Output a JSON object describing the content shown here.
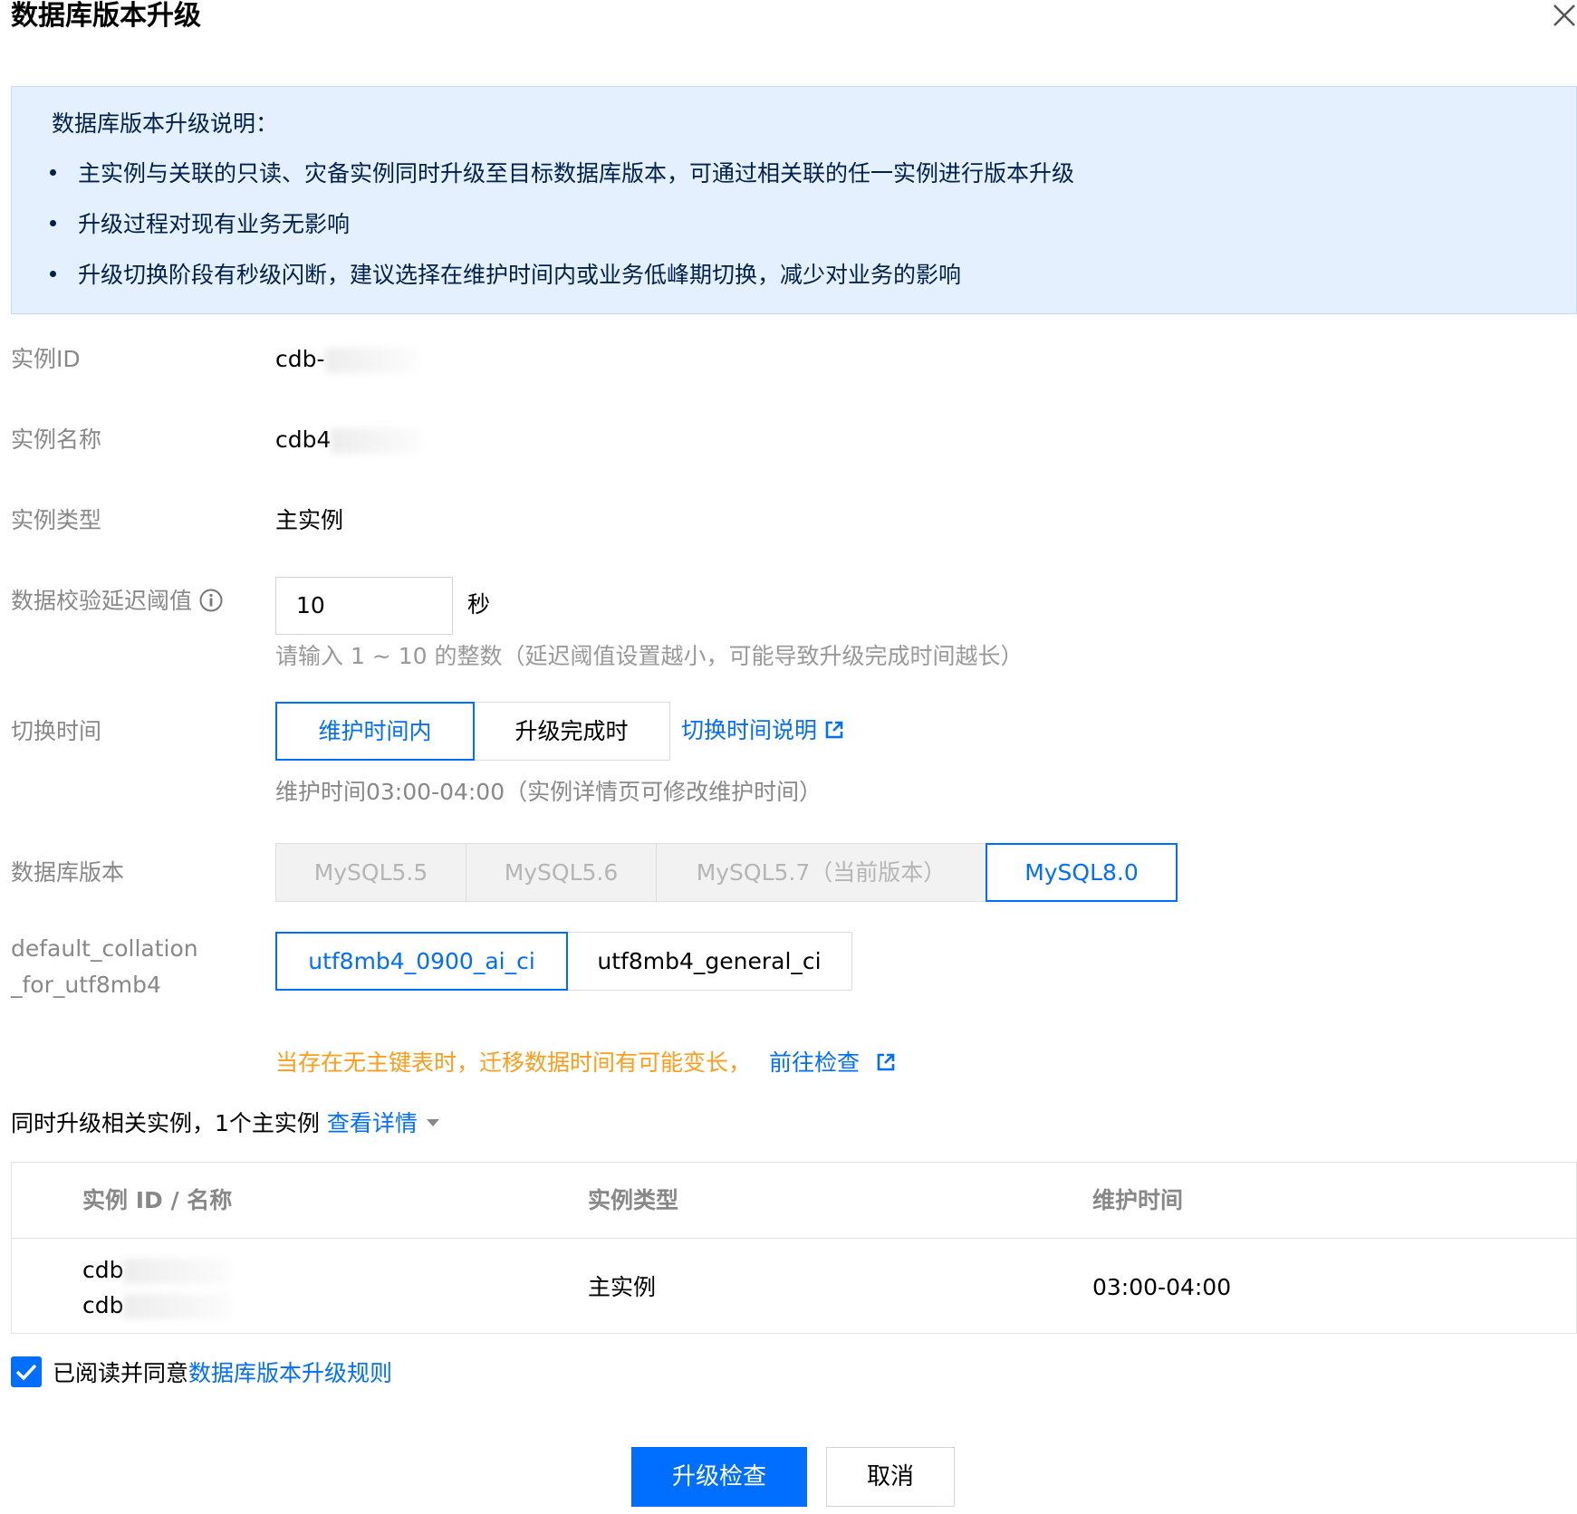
{
  "dialog": {
    "title": "数据库版本升级",
    "close_icon": "close-icon"
  },
  "notice": {
    "heading": "数据库版本升级说明：",
    "bullets": [
      "主实例与关联的只读、灾备实例同时升级至目标数据库版本，可通过相关联的任一实例进行版本升级",
      "升级过程对现有业务无影响",
      "升级切换阶段有秒级闪断，建议选择在维护时间内或业务低峰期切换，减少对业务的影响"
    ]
  },
  "form": {
    "instance_id": {
      "label": "实例ID",
      "value": "cdb-"
    },
    "instance_name": {
      "label": "实例名称",
      "value": "cdb4"
    },
    "instance_type": {
      "label": "实例类型",
      "value": "主实例"
    },
    "delay_threshold": {
      "label": "数据校验延迟阈值",
      "icon": "info-icon",
      "value": "10",
      "unit": "秒",
      "hint": "请输入 1 ~ 10 的整数（延迟阈值设置越小，可能导致升级完成时间越长）"
    },
    "switch_time": {
      "label": "切换时间",
      "options": [
        "维护时间内",
        "升级完成时"
      ],
      "selected": "维护时间内",
      "help_link": "切换时间说明",
      "hint": "维护时间03:00-04:00（实例详情页可修改维护时间）"
    },
    "db_version": {
      "label": "数据库版本",
      "options": [
        "MySQL5.5",
        "MySQL5.6",
        "MySQL5.7（当前版本）",
        "MySQL8.0"
      ],
      "selected": "MySQL8.0"
    },
    "collation": {
      "label_line1": "default_collation",
      "label_line2": "_for_utf8mb4",
      "options": [
        "utf8mb4_0900_ai_ci",
        "utf8mb4_general_ci"
      ],
      "selected": "utf8mb4_0900_ai_ci"
    },
    "warning": {
      "text": "当存在无主键表时，迁移数据时间有可能变长，",
      "link": "前往检查"
    }
  },
  "related": {
    "text": "同时升级相关实例，1个主实例",
    "link": "查看详情",
    "table": {
      "headers": [
        "实例 ID / 名称",
        "实例类型",
        "维护时间"
      ],
      "rows": [
        {
          "id": "cdb",
          "name": "cdb",
          "type": "主实例",
          "maintenance": "03:00-04:00"
        }
      ]
    }
  },
  "agreement": {
    "checked": true,
    "text": "已阅读并同意",
    "link": "数据库版本升级规则"
  },
  "footer": {
    "primary": "升级检查",
    "cancel": "取消"
  },
  "colors": {
    "accent": "#006eff",
    "notice_bg": "#e5f0ff",
    "warning": "#ff9c19"
  }
}
